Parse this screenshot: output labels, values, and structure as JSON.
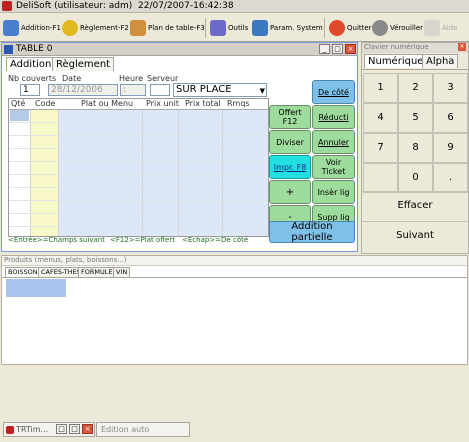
{
  "app": {
    "title": "DeliSoft (utilisateur: adm)",
    "datetime": "22/07/2007-16:42:38"
  },
  "toolbar": {
    "addition": "Addition-F1",
    "reglement": "Règlement-F2",
    "plan": "Plan de table-F3",
    "outils": "Outils",
    "param": "Param. System",
    "quitter": "Quitter",
    "verrouiller": "Vérouiller",
    "aide": "Aide"
  },
  "doc_window": {
    "title": "TABLE 0",
    "tabs": [
      "Addition",
      "Règlement"
    ],
    "labels": {
      "nb_couverts": "Nb couverts",
      "date": "Date",
      "heure": "Heure",
      "serveur": "Serveur"
    },
    "values": {
      "nb_couverts": "1",
      "date": "28/12/2006",
      "heure": ":",
      "service": "SUR PLACE"
    },
    "columns": [
      "Qté",
      "Code",
      "Plat ou Menu",
      "Prix unit",
      "Prix total",
      "Rmqs"
    ],
    "buttons": {
      "de_cote": "De côté",
      "offert": "Offert F12",
      "reduction": "Réducti",
      "diviser": "Diviser",
      "annuler": "Annuler",
      "impr": "Impr. F8",
      "voir_ticket": "Voir Ticket",
      "plus": "+",
      "inser_lig": "Insèr lig",
      "minus": "-",
      "supp_lig": "Supp lig",
      "addition_partielle": "Addition partielle"
    },
    "hints": [
      "<Entrée>=Champs suivant",
      "<F12>=Plat offert",
      "<Echap>=De côté"
    ]
  },
  "keypad": {
    "title": "Clavier numérique",
    "tabs": [
      "Numérique",
      "Alpha"
    ],
    "keys": [
      "1",
      "2",
      "3",
      "4",
      "5",
      "6",
      "7",
      "8",
      "9",
      "0",
      "."
    ],
    "effacer": "Effacer",
    "suivant": "Suivant"
  },
  "products": {
    "title": "Produits (menus, plats, boissons...)",
    "tabs": [
      "BOISSONS",
      "CAFES-THES",
      "FORMULES",
      "VIN"
    ]
  },
  "taskbar": {
    "item1": "TRTim...",
    "item2": "Edition auto"
  },
  "colors": {
    "green_button": "#9edc9e",
    "blue_button": "#7ec0e8",
    "cyan_button": "#22e0e0",
    "window_border": "#7a96df"
  }
}
